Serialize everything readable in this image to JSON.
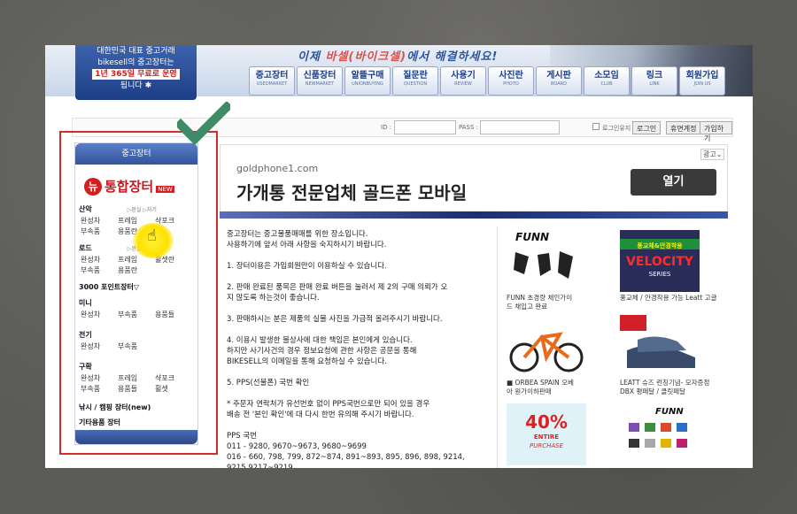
{
  "header": {
    "promo_line1": "대한민국 대표 중고거래",
    "promo_line2": "bikesell의 중고장터는",
    "promo_red": "1년 365일 무료로 운영",
    "promo_line4": "됩니다",
    "slogan_a": "이제 ",
    "slogan_b": "바셀(바이크셀)",
    "slogan_c": "에서 해결하세요!"
  },
  "nav": [
    {
      "ko": "중고장터",
      "en": "USEDMARKET"
    },
    {
      "ko": "신품장터",
      "en": "NEWMARKET"
    },
    {
      "ko": "알뜰구매",
      "en": "UNIONBUYING"
    },
    {
      "ko": "질문란",
      "en": "QUESTION"
    },
    {
      "ko": "사용기",
      "en": "REVIEW"
    },
    {
      "ko": "사진란",
      "en": "PHOTO"
    },
    {
      "ko": "게시판",
      "en": "BOARD"
    },
    {
      "ko": "소모임",
      "en": "CLUB"
    },
    {
      "ko": "링크",
      "en": "LINK"
    },
    {
      "ko": "회원가입",
      "en": "JOIN US"
    }
  ],
  "login": {
    "id_label": "ID :",
    "pass_label": "PASS :",
    "autosave": "로그인유지",
    "login_btn": "로그인",
    "find_btn": "휴면계정",
    "join_btn": "가입하기"
  },
  "sidebar": {
    "title": "중고장터",
    "logo_n": "뉴",
    "logo_text": "통합장터",
    "logo_new": "NEW",
    "cat_mtb": "산악",
    "cat_mtb_sub": "▷완실 ▷자기",
    "mtb_row1": [
      "완성차",
      "프레임",
      "샥포크"
    ],
    "mtb_row2": [
      "부속품",
      "용품란"
    ],
    "cat_road": "로드",
    "cat_road_sub": "▷완실",
    "road_row1": [
      "완성차",
      "프레임",
      "휠셋란"
    ],
    "road_row2": [
      "부속품",
      "용품란"
    ],
    "cat_point": "3000 포인트장터▽",
    "cat_mini": "미니",
    "mini_row": [
      "완성차",
      "부속품",
      "용품들"
    ],
    "cat_elec": "전기",
    "elec_row": [
      "완성차",
      "부속품"
    ],
    "cat_old": "구확",
    "old_row1": [
      "완성차",
      "프레임",
      "샥포크"
    ],
    "old_row2": [
      "부속품",
      "용품들",
      "휠셋"
    ],
    "cat_fish": "낚시 / 캠핑 장터(new)",
    "cat_etc": "기타용품 장터"
  },
  "ad": {
    "domain": "goldphone1.com",
    "title": "가개통 전문업체 골드폰 모바일",
    "button": "열기",
    "tag": "광고⌄"
  },
  "notice": [
    "중고장터는 중고물품매매를 위한 장소입니다.\n사용하기에 앞서 아래 사항을 숙지하시기 바랍니다.",
    "1. 장터이용은 가입회원만이 이용하실 수 있습니다.",
    "2. 판매 완료된 품목은 판매 완료 버튼을 눌러서 제 2의 구매 의뢰가 오\n지 않도록 하는것이 좋습니다.",
    "3. 판매하시는 분은 제품의 실물 사진을 가급적 올려주시기 바랍니다.",
    "4. 이용시 발생한 불상사에 대한 책임은 본인에게 있습니다.\n하지만 사기사건의 경우 정보요청에 관한 사항은 공문을 통해\nBIKESELL의 이메일을 통해 요청하실 수 있습니다.",
    "5. PPS(선불폰) 국번 확인",
    "* 주문자 연락처가 유선번호 없이 PPS국번으로만 되어 있을 경우\n배송 전 '본인 확인'에 대 다시 한번 유의해 주시기 바랍니다.",
    "PPS 국번\n011 - 9280, 9670~9673, 9680~9699\n016 - 660, 798, 799, 872~874, 891~893, 895, 896, 898, 9214,\n9215,9217~9219,"
  ],
  "products": [
    {
      "caption": "FUNN 초경량 체인가이\n드 채입고 완료",
      "brand": "FUNN"
    },
    {
      "caption": "풍교체 / 안경착용 가능 Leatt 고글",
      "brand": "풍교체&안경착용 VELOCITY SERIES"
    },
    {
      "caption": "■ ORBEA SPAIN 오베\n아 원가이하판매"
    },
    {
      "caption": "LEATT 슈즈 런칭기념- 모자증정\nDBX 평페달 / 클릿페달"
    },
    {
      "caption": "",
      "brand": "40% ENTIRE PURCHASE"
    },
    {
      "caption": "",
      "brand": "FUNN"
    }
  ]
}
